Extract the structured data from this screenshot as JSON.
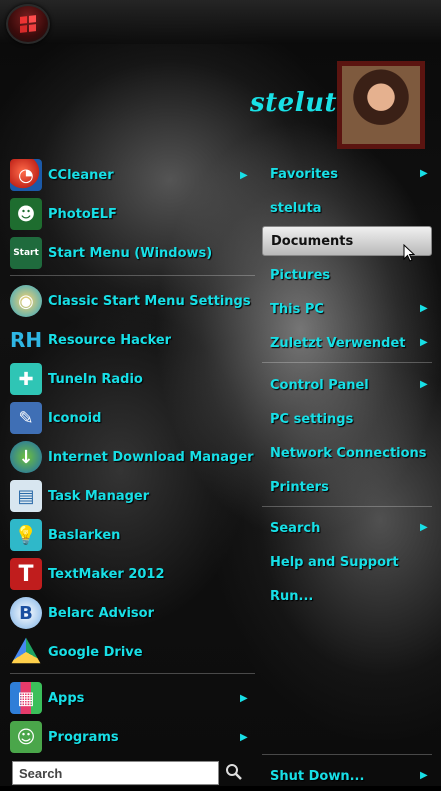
{
  "user": {
    "name": "steluta"
  },
  "pinned": [
    {
      "label": "CCleaner",
      "icon": "ccleaner-icon",
      "has_arrow": true
    },
    {
      "label": "PhotoELF",
      "icon": "photoelf-icon",
      "has_arrow": false
    },
    {
      "label": "Start Menu (Windows)",
      "icon": "start-menu-icon",
      "has_arrow": false
    }
  ],
  "recent": [
    {
      "label": "Classic Start Menu Settings",
      "icon": "shell-icon"
    },
    {
      "label": "Resource Hacker",
      "icon": "rh-icon"
    },
    {
      "label": "TuneIn Radio",
      "icon": "tunein-icon"
    },
    {
      "label": "Iconoid",
      "icon": "iconoid-icon"
    },
    {
      "label": "Internet Download Manager",
      "icon": "idm-icon"
    },
    {
      "label": "Task Manager",
      "icon": "task-manager-icon"
    },
    {
      "label": "Baslarken",
      "icon": "lightbulb-icon"
    },
    {
      "label": "TextMaker 2012",
      "icon": "textmaker-icon"
    },
    {
      "label": "Belarc Advisor",
      "icon": "belarc-icon"
    },
    {
      "label": "Google Drive",
      "icon": "google-drive-icon"
    }
  ],
  "bottom_left": [
    {
      "label": "Apps",
      "icon": "apps-icon"
    },
    {
      "label": "Programs",
      "icon": "programs-icon"
    }
  ],
  "right": [
    {
      "label": "Favorites",
      "arrow": true
    },
    {
      "label": "steluta",
      "arrow": false
    },
    {
      "label": "Documents",
      "arrow": false,
      "selected": true
    },
    {
      "label": "Pictures",
      "arrow": false
    },
    {
      "label": "This PC",
      "arrow": true
    },
    {
      "label": "Zuletzt Verwendet",
      "arrow": true
    },
    {
      "label": "Control Panel",
      "arrow": true
    },
    {
      "label": "PC settings",
      "arrow": false
    },
    {
      "label": "Network Connections",
      "arrow": false
    },
    {
      "label": "Printers",
      "arrow": false
    },
    {
      "label": "Search",
      "arrow": true
    },
    {
      "label": "Help and Support",
      "arrow": false
    },
    {
      "label": "Run...",
      "arrow": false
    },
    {
      "label": "Shut Down...",
      "arrow": true
    }
  ],
  "search": {
    "placeholder": "Search"
  },
  "colors": {
    "text": "#18dfe6",
    "frame": "#5b1410",
    "orb": "#e33333"
  }
}
